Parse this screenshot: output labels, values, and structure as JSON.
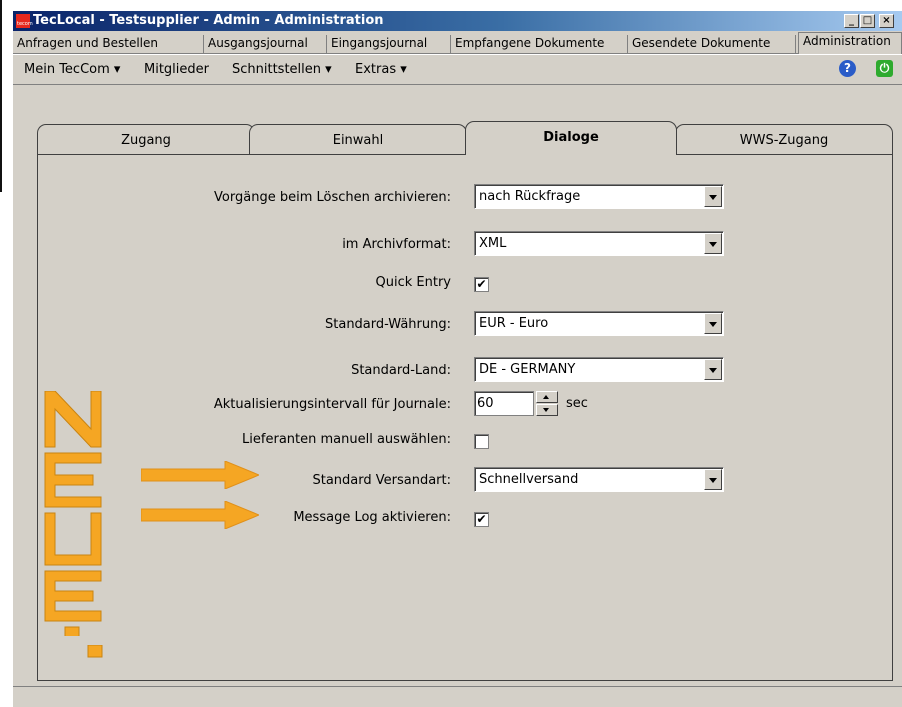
{
  "window": {
    "title": "TecLocal - Testsupplier - Admin - Administration",
    "app_icon_text": "tecom",
    "controls": {
      "minimize": "_",
      "maximize": "□",
      "close": "×"
    }
  },
  "nav_tabs": [
    {
      "label": "Anfragen und Bestellen"
    },
    {
      "label": "Ausgangsjournal"
    },
    {
      "label": "Eingangsjournal"
    },
    {
      "label": "Empfangene Dokumente"
    },
    {
      "label": "Gesendete Dokumente"
    },
    {
      "label": "Administration",
      "active": true
    }
  ],
  "menu": [
    {
      "label": "Mein TecCom ▾"
    },
    {
      "label": "Mitglieder"
    },
    {
      "label": "Schnittstellen ▾"
    },
    {
      "label": "Extras ▾"
    }
  ],
  "toolbar_icons": {
    "help": "?",
    "power": "⏻"
  },
  "dialog_tabs": [
    {
      "label": "Zugang"
    },
    {
      "label": "Einwahl"
    },
    {
      "label": "Dialoge",
      "active": true
    },
    {
      "label": "WWS-Zugang"
    }
  ],
  "settings": {
    "archive_on_delete": {
      "label": "Vorgänge beim Löschen archivieren:",
      "value": "nach Rückfrage"
    },
    "archive_format": {
      "label": "im Archivformat:",
      "value": "XML"
    },
    "quick_entry": {
      "label": "Quick Entry",
      "checked": "✔"
    },
    "currency": {
      "label": "Standard-Währung:",
      "value": "EUR - Euro"
    },
    "country": {
      "label": "Standard-Land:",
      "value": "DE - GERMANY"
    },
    "refresh_interval": {
      "label": "Aktualisierungsintervall für Journale:",
      "value": "60",
      "unit": "sec"
    },
    "manual_suppliers": {
      "label": "Lieferanten manuell auswählen:",
      "checked": ""
    },
    "shipping": {
      "label": "Standard Versandart:",
      "value": "Schnellversand"
    },
    "message_log": {
      "label": "Message Log aktivieren:",
      "checked": "✔"
    }
  },
  "annotation": {
    "text": "NEUE!",
    "color": "#f5a623"
  }
}
